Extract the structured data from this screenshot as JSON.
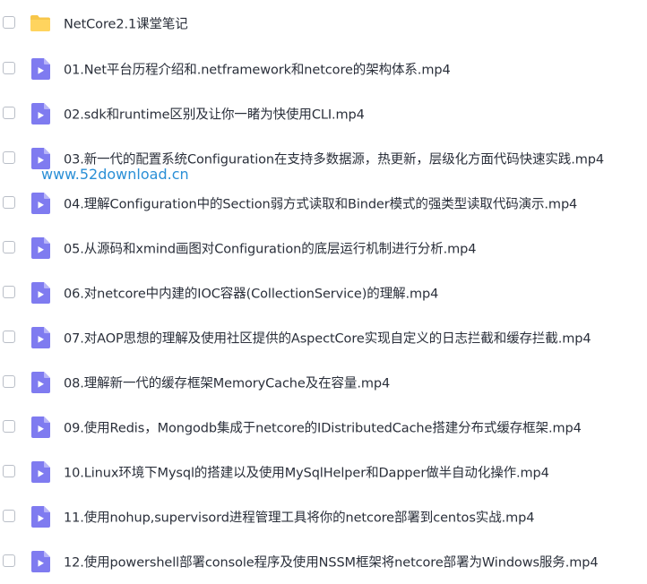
{
  "items": [
    {
      "type": "folder",
      "icon": "folder-icon",
      "label": "NetCore2.1课堂笔记"
    },
    {
      "type": "video",
      "icon": "video-file-icon",
      "label": "01.Net平台历程介绍和.netframework和netcore的架构体系.mp4"
    },
    {
      "type": "video",
      "icon": "video-file-icon",
      "label": "02.sdk和runtime区别及让你一睹为快使用CLI.mp4"
    },
    {
      "type": "video",
      "icon": "video-file-icon",
      "label": "03.新一代的配置系统Configuration在支持多数据源，热更新，层级化方面代码快速实践.mp4"
    },
    {
      "type": "video",
      "icon": "video-file-icon",
      "label": "04.理解Configuration中的Section弱方式读取和Binder模式的强类型读取代码演示.mp4"
    },
    {
      "type": "video",
      "icon": "video-file-icon",
      "label": "05.从源码和xmind画图对Configuration的底层运行机制进行分析.mp4"
    },
    {
      "type": "video",
      "icon": "video-file-icon",
      "label": "06.对netcore中内建的IOC容器(CollectionService)的理解.mp4"
    },
    {
      "type": "video",
      "icon": "video-file-icon",
      "label": "07.对AOP思想的理解及使用社区提供的AspectCore实现自定义的日志拦截和缓存拦截.mp4"
    },
    {
      "type": "video",
      "icon": "video-file-icon",
      "label": "08.理解新一代的缓存框架MemoryCache及在容量.mp4"
    },
    {
      "type": "video",
      "icon": "video-file-icon",
      "label": "09.使用Redis，Mongodb集成于netcore的IDistributedCache搭建分布式缓存框架.mp4"
    },
    {
      "type": "video",
      "icon": "video-file-icon",
      "label": "10.Linux环境下Mysql的搭建以及使用MySqlHelper和Dapper做半自动化操作.mp4"
    },
    {
      "type": "video",
      "icon": "video-file-icon",
      "label": "11.使用nohup,supervisord进程管理工具将你的netcore部署到centos实战.mp4"
    },
    {
      "type": "video",
      "icon": "video-file-icon",
      "label": "12.使用powershell部署console程序及使用NSSM框架将netcore部署为Windows服务.mp4"
    }
  ],
  "watermark": "www.52download.cn",
  "colors": {
    "folder": "#f7c64a",
    "video": "#7f7bf0",
    "text": "#2a2f3a",
    "watermark": "#2a8fd6"
  }
}
